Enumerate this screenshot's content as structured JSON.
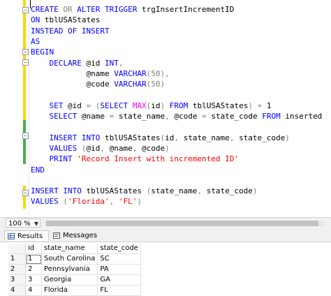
{
  "editor": {
    "lines": [
      [
        {
          "t": "CREATE ",
          "c": "kw"
        },
        {
          "t": "OR ",
          "c": "gray"
        },
        {
          "t": "ALTER TRIGGER ",
          "c": "kw"
        },
        {
          "t": "trgInsertIncrementID",
          "c": ""
        }
      ],
      [
        {
          "t": "ON ",
          "c": "kw"
        },
        {
          "t": "tblUSAStates",
          "c": ""
        }
      ],
      [
        {
          "t": "INSTEAD OF INSERT",
          "c": "kw"
        }
      ],
      [
        {
          "t": "AS",
          "c": "kw"
        }
      ],
      [
        {
          "t": "BEGIN",
          "c": "kw"
        }
      ],
      [
        {
          "t": "    DECLARE ",
          "c": "kw"
        },
        {
          "t": "@id ",
          "c": ""
        },
        {
          "t": "INT",
          "c": "kw"
        },
        {
          "t": ",",
          "c": "gray"
        }
      ],
      [
        {
          "t": "            @name ",
          "c": ""
        },
        {
          "t": "VARCHAR",
          "c": "kw"
        },
        {
          "t": "(50),",
          "c": "gray"
        }
      ],
      [
        {
          "t": "            @code ",
          "c": ""
        },
        {
          "t": "VARCHAR",
          "c": "kw"
        },
        {
          "t": "(50)",
          "c": "gray"
        }
      ],
      [],
      [
        {
          "t": "    SET ",
          "c": "kw"
        },
        {
          "t": "@id ",
          "c": ""
        },
        {
          "t": "= (",
          "c": "gray"
        },
        {
          "t": "SELECT ",
          "c": "kw"
        },
        {
          "t": "MAX",
          "c": "fn"
        },
        {
          "t": "(",
          "c": "gray"
        },
        {
          "t": "id",
          "c": ""
        },
        {
          "t": ") ",
          "c": "gray"
        },
        {
          "t": "FROM ",
          "c": "kw"
        },
        {
          "t": "tblUSAStates",
          "c": ""
        },
        {
          "t": ") + ",
          "c": "gray"
        },
        {
          "t": "1",
          "c": ""
        }
      ],
      [
        {
          "t": "    SELECT ",
          "c": "kw"
        },
        {
          "t": "@name ",
          "c": ""
        },
        {
          "t": "= ",
          "c": "gray"
        },
        {
          "t": "state_name",
          "c": ""
        },
        {
          "t": ", ",
          "c": "gray"
        },
        {
          "t": "@code ",
          "c": ""
        },
        {
          "t": "= ",
          "c": "gray"
        },
        {
          "t": "state_code ",
          "c": ""
        },
        {
          "t": "FROM ",
          "c": "kw"
        },
        {
          "t": "inserted",
          "c": ""
        }
      ],
      [],
      [
        {
          "t": "    INSERT INTO ",
          "c": "kw"
        },
        {
          "t": "tblUSAStates",
          "c": ""
        },
        {
          "t": "(",
          "c": "gray"
        },
        {
          "t": "id",
          "c": ""
        },
        {
          "t": ", ",
          "c": "gray"
        },
        {
          "t": "state_name",
          "c": ""
        },
        {
          "t": ", ",
          "c": "gray"
        },
        {
          "t": "state_code",
          "c": ""
        },
        {
          "t": ")",
          "c": "gray"
        }
      ],
      [
        {
          "t": "    VALUES ",
          "c": "kw"
        },
        {
          "t": "(",
          "c": "gray"
        },
        {
          "t": "@id",
          "c": ""
        },
        {
          "t": ", ",
          "c": "gray"
        },
        {
          "t": "@name",
          "c": ""
        },
        {
          "t": ", ",
          "c": "gray"
        },
        {
          "t": "@code",
          "c": ""
        },
        {
          "t": ")",
          "c": "gray"
        }
      ],
      [
        {
          "t": "    PRINT ",
          "c": "kw"
        },
        {
          "t": "'Record Insert with incremented ID'",
          "c": "str"
        }
      ],
      [
        {
          "t": "END",
          "c": "kw"
        }
      ],
      [],
      [
        {
          "t": "INSERT INTO ",
          "c": "kw"
        },
        {
          "t": "tblUSAStates ",
          "c": ""
        },
        {
          "t": "(",
          "c": "gray"
        },
        {
          "t": "state_name",
          "c": ""
        },
        {
          "t": ", ",
          "c": "gray"
        },
        {
          "t": "state_code",
          "c": ""
        },
        {
          "t": ")",
          "c": "gray"
        }
      ],
      [
        {
          "t": "VALUES ",
          "c": "kw"
        },
        {
          "t": "(",
          "c": "gray"
        },
        {
          "t": "'Florida'",
          "c": "str"
        },
        {
          "t": ", ",
          "c": "gray"
        },
        {
          "t": "'FL'",
          "c": "str"
        },
        {
          "t": ")",
          "c": "gray"
        }
      ]
    ]
  },
  "zoom": {
    "value": "100 %"
  },
  "tabs": {
    "results": "Results",
    "messages": "Messages"
  },
  "grid": {
    "columns": [
      "id",
      "state_name",
      "state_code"
    ],
    "rows": [
      {
        "num": "1",
        "cells": [
          "1",
          "South Carolina",
          "SC"
        ]
      },
      {
        "num": "2",
        "cells": [
          "2",
          "Pennsylvania",
          "PA"
        ]
      },
      {
        "num": "3",
        "cells": [
          "3",
          "Georgia",
          "GA"
        ]
      },
      {
        "num": "4",
        "cells": [
          "4",
          "Florida",
          "FL"
        ]
      }
    ]
  }
}
